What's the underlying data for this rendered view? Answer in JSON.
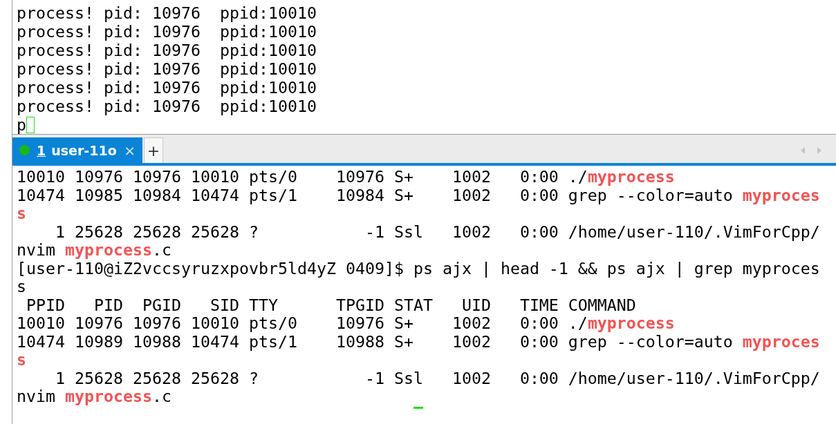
{
  "top_terminal": {
    "lines": [
      {
        "segments": [
          {
            "text": "process! pid: 10976  ppid:10010",
            "highlight": false
          }
        ]
      },
      {
        "segments": [
          {
            "text": "process! pid: 10976  ppid:10010",
            "highlight": false
          }
        ]
      },
      {
        "segments": [
          {
            "text": "process! pid: 10976  ppid:10010",
            "highlight": false
          }
        ]
      },
      {
        "segments": [
          {
            "text": "process! pid: 10976  ppid:10010",
            "highlight": false
          }
        ]
      },
      {
        "segments": [
          {
            "text": "process! pid: 10976  ppid:10010",
            "highlight": false
          }
        ]
      },
      {
        "segments": [
          {
            "text": "process! pid: 10976  ppid:10010",
            "highlight": false
          }
        ]
      },
      {
        "segments": [
          {
            "text": "p",
            "highlight": false
          }
        ],
        "cursor": true
      }
    ],
    "focused": false
  },
  "tabs": [
    {
      "number": "1",
      "label": "user-11o",
      "selected": true,
      "connected": true,
      "close": "×"
    }
  ],
  "new_tab": "+",
  "bottom_terminal": {
    "lines": [
      {
        "segments": [
          {
            "text": "10010 10976 10976 10010 pts/0    10976 S+    1002   0:00 ./",
            "highlight": false
          },
          {
            "text": "myprocess",
            "highlight": true
          }
        ]
      },
      {
        "segments": [
          {
            "text": "10474 10985 10984 10474 pts/1    10984 S+    1002   0:00 grep --color=auto ",
            "highlight": false
          },
          {
            "text": "myproces",
            "highlight": true
          }
        ]
      },
      {
        "segments": [
          {
            "text": "s",
            "highlight": true
          }
        ]
      },
      {
        "segments": [
          {
            "text": "    1 25628 25628 25628 ?           -1 Ssl   1002   0:00 /home/user-110/.VimForCpp/",
            "highlight": false
          }
        ]
      },
      {
        "segments": [
          {
            "text": "nvim ",
            "highlight": false
          },
          {
            "text": "myprocess",
            "highlight": true
          },
          {
            "text": ".c",
            "highlight": false
          }
        ]
      },
      {
        "segments": [
          {
            "text": "[user-110@iZ2vccsyruzxpovbr5ld4yZ 0409]$ ps ajx | head -1 && ps ajx | grep myproces",
            "highlight": false
          }
        ]
      },
      {
        "segments": [
          {
            "text": "s",
            "highlight": false
          }
        ]
      },
      {
        "segments": [
          {
            "text": " PPID   PID  PGID   SID TTY      TPGID STAT   UID   TIME COMMAND",
            "highlight": false
          }
        ]
      },
      {
        "segments": [
          {
            "text": "10010 10976 10976 10010 pts/0    10976 S+    1002   0:00 ./",
            "highlight": false
          },
          {
            "text": "myprocess",
            "highlight": true
          }
        ]
      },
      {
        "segments": [
          {
            "text": "10474 10989 10988 10474 pts/1    10988 S+    1002   0:00 grep --color=auto ",
            "highlight": false
          },
          {
            "text": "myproces",
            "highlight": true
          }
        ]
      },
      {
        "segments": [
          {
            "text": "s",
            "highlight": true
          }
        ]
      },
      {
        "segments": [
          {
            "text": "    1 25628 25628 25628 ?           -1 Ssl   1002   0:00 /home/user-110/.VimForCpp/",
            "highlight": false
          }
        ]
      },
      {
        "segments": [
          {
            "text": "nvim ",
            "highlight": false
          },
          {
            "text": "myprocess",
            "highlight": true
          },
          {
            "text": ".c",
            "highlight": false
          }
        ]
      },
      {
        "cursor": true
      }
    ],
    "focused": true
  }
}
